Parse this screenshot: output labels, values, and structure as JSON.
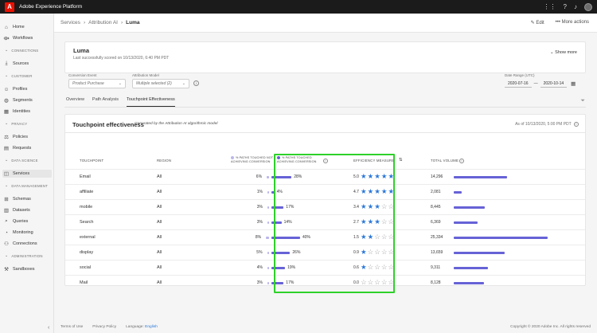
{
  "app": {
    "title": "Adobe Experience Platform",
    "logo_letter": "A"
  },
  "topbar_icons": [
    "apps-grid-icon",
    "help-icon",
    "bell-icon",
    "avatar"
  ],
  "sidebar": {
    "items": [
      {
        "label": "Home",
        "icon": "home-icon"
      },
      {
        "label": "Workflows",
        "icon": "workflow-icon"
      },
      {
        "section": "CONNECTIONS"
      },
      {
        "label": "Sources",
        "icon": "sources-icon"
      },
      {
        "section": "CUSTOMER"
      },
      {
        "label": "Profiles",
        "icon": "profile-icon"
      },
      {
        "label": "Segments",
        "icon": "segments-icon"
      },
      {
        "label": "Identities",
        "icon": "identities-icon"
      },
      {
        "section": "PRIVACY"
      },
      {
        "label": "Policies",
        "icon": "policies-icon"
      },
      {
        "label": "Requests",
        "icon": "requests-icon"
      },
      {
        "section": "DATA SCIENCE"
      },
      {
        "label": "Services",
        "icon": "services-icon",
        "active": true
      },
      {
        "section": "DATA MANAGEMENT"
      },
      {
        "label": "Schemas",
        "icon": "schemas-icon"
      },
      {
        "label": "Datasets",
        "icon": "datasets-icon"
      },
      {
        "label": "Queries",
        "icon": "queries-icon"
      },
      {
        "label": "Monitoring",
        "icon": "monitoring-icon"
      },
      {
        "label": "Connections",
        "icon": "connections-icon"
      },
      {
        "section": "ADMINISTRATION"
      },
      {
        "label": "Sandboxes",
        "icon": "sandboxes-icon"
      }
    ]
  },
  "breadcrumb": {
    "items": [
      "Services",
      "Attribution AI",
      "Luma"
    ]
  },
  "actions": {
    "edit": "Edit",
    "more": "More actions"
  },
  "summary": {
    "title": "Luma",
    "subtitle": "Last successfully scored on 10/13/2020, 6:40 PM PDT",
    "show_more": "Show more"
  },
  "filters": {
    "conversion_event_label": "Conversion Event",
    "conversion_event_value": "Product Purchase",
    "attribution_model_label": "Attribution Model",
    "attribution_model_value": "Multiple selected (2)",
    "date_range_label": "Date Range (UTC)",
    "date_from": "2020-07-16",
    "date_to": "2020-10-14",
    "date_sep": "—"
  },
  "tabs": [
    "Overview",
    "Path Analysis",
    "Touchpoint Effectiveness"
  ],
  "selected_tab": 2,
  "panel": {
    "title": "Touchpoint effectiveness",
    "generated_by": "Generated by the Attribution AI algorithmic model",
    "as_of": "As of 10/13/2020, 5:00 PM PDT",
    "headers": {
      "touchpoint": "TOUCHPOINT",
      "region": "REGION",
      "not_achieving": "% PATHS TOUCHED NOT ACHIEVING CONVERSION",
      "achieving": "% PATHS TOUCHED ACHIEVING CONVERSION",
      "efficiency": "EFFICIENCY MEASURE",
      "volume": "TOTAL VOLUME"
    },
    "rows": [
      {
        "touchpoint": "Email",
        "region": "All",
        "not_pct": "6%",
        "not_val": 6,
        "ach_pct": "28%",
        "ach_val": 28,
        "eff": "5.0",
        "stars": 5,
        "vol": "14,296",
        "vol_val": 14296
      },
      {
        "touchpoint": "affiliate",
        "region": "All",
        "not_pct": "1%",
        "not_val": 1,
        "ach_pct": "4%",
        "ach_val": 4,
        "eff": "4.7",
        "stars": 5,
        "vol": "2,081",
        "vol_val": 2081
      },
      {
        "touchpoint": "mobile",
        "region": "All",
        "not_pct": "3%",
        "not_val": 3,
        "ach_pct": "17%",
        "ach_val": 17,
        "eff": "3.4",
        "stars": 3,
        "vol": "8,445",
        "vol_val": 8445
      },
      {
        "touchpoint": "Search",
        "region": "All",
        "not_pct": "3%",
        "not_val": 3,
        "ach_pct": "14%",
        "ach_val": 14,
        "eff": "2.7",
        "stars": 3,
        "vol": "6,369",
        "vol_val": 6369
      },
      {
        "touchpoint": "external",
        "region": "All",
        "not_pct": "8%",
        "not_val": 8,
        "ach_pct": "40%",
        "ach_val": 40,
        "eff": "1.5",
        "stars": 2,
        "vol": "25,334",
        "vol_val": 25334
      },
      {
        "touchpoint": "display",
        "region": "All",
        "not_pct": "5%",
        "not_val": 5,
        "ach_pct": "26%",
        "ach_val": 26,
        "eff": "0.9",
        "stars": 1,
        "vol": "13,659",
        "vol_val": 13659
      },
      {
        "touchpoint": "social",
        "region": "All",
        "not_pct": "4%",
        "not_val": 4,
        "ach_pct": "19%",
        "ach_val": 19,
        "eff": "0.6",
        "stars": 1,
        "vol": "9,311",
        "vol_val": 9311
      },
      {
        "touchpoint": "Mail",
        "region": "All",
        "not_pct": "3%",
        "not_val": 3,
        "ach_pct": "17%",
        "ach_val": 17,
        "eff": "0.0",
        "stars": 0,
        "vol": "8,128",
        "vol_val": 8128
      }
    ]
  },
  "footer": {
    "terms": "Terms of Use",
    "privacy": "Privacy Policy",
    "language_label": "Language:",
    "language": "English",
    "copyright": "Copyright © 2020 Adobe Inc. All rights reserved"
  },
  "colors": {
    "bar": "#6662d6",
    "bar_light": "#b9b7ea",
    "star_on": "#2c78d8",
    "highlight": "#2ed12a",
    "topbar": "#1b1b1b",
    "logo": "#eb1000"
  }
}
